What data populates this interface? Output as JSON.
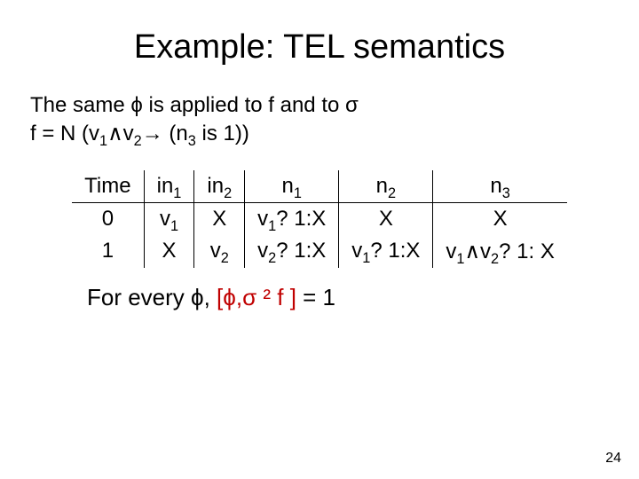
{
  "title": "Example: TEL semantics",
  "intro": {
    "line1_pre": "The same ",
    "phi": "ϕ",
    "line1_mid": " is applied to f and to ",
    "sigma": "σ",
    "line2_pre": "f = N (v",
    "line2_sub1": "1",
    "line2_wedge": "∧",
    "line2_v2": "v",
    "line2_sub2": "2",
    "line2_arrow": "→",
    "line2_post": " (n",
    "line2_sub3": "3",
    "line2_end": " is 1))"
  },
  "table": {
    "headers": {
      "c0": "Time",
      "c1_pre": "in",
      "c1_sub": "1",
      "c2_pre": "in",
      "c2_sub": "2",
      "c3_pre": "n",
      "c3_sub": "1",
      "c4_pre": "n",
      "c4_sub": "2",
      "c5_pre": "n",
      "c5_sub": "3"
    },
    "rows": [
      {
        "time": "0",
        "in1_pre": "v",
        "in1_sub": "1",
        "in2": "X",
        "n1_pre": "v",
        "n1_sub": "1",
        "n1_tail": "? 1:X",
        "n2": "X",
        "n3": "X"
      },
      {
        "time": "1",
        "in1": "X",
        "in2_pre": "v",
        "in2_sub": "2",
        "n1_pre": "v",
        "n1_sub": "2",
        "n1_tail": "? 1:X",
        "n2_pre": "v",
        "n2_sub": "1",
        "n2_tail": "? 1:X",
        "n3_a_pre": "v",
        "n3_a_sub": "1",
        "n3_wedge": "∧",
        "n3_b_pre": "v",
        "n3_b_sub": "2",
        "n3_tail": "? 1: X"
      }
    ]
  },
  "footer": {
    "pre": "For every ",
    "phi": "ϕ",
    "comma": ",  ",
    "br_open": "[",
    "phi2": "ϕ",
    "sep": ",",
    "sigma": "σ",
    "models": " ² ",
    "f": "f ",
    "br_close": "]",
    "eq": " = 1"
  },
  "page": "24"
}
